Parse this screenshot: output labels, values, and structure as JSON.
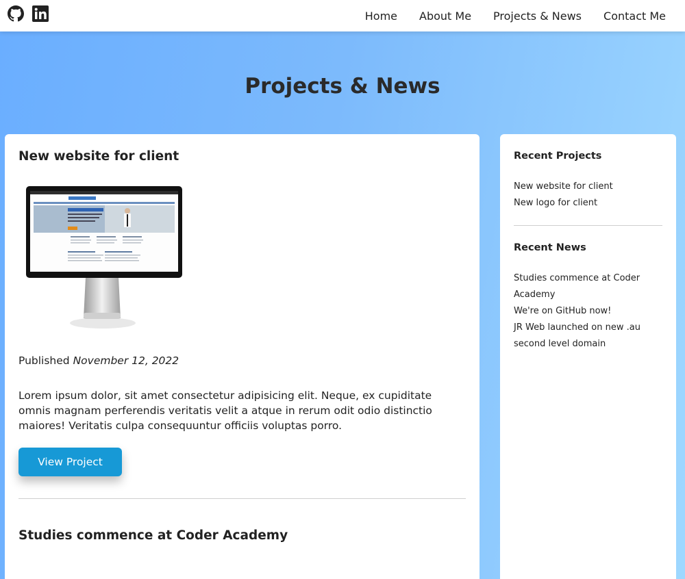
{
  "nav": {
    "github_icon": "github-icon",
    "linkedin_icon": "linkedin-icon",
    "links": [
      "Home",
      "About Me",
      "Projects & News",
      "Contact Me"
    ]
  },
  "page": {
    "title": "Projects & News"
  },
  "posts": [
    {
      "title": "New website for client",
      "image": "monitor-website-screenshot",
      "published_label": "Published",
      "published_date": "November 12, 2022",
      "body": "Lorem ipsum dolor, sit amet consectetur adipisicing elit. Neque, ex cupiditate omnis magnam perferendis veritatis velit a atque in rerum odit odio distinctio maiores! Veritatis culpa consequuntur officiis voluptas porro.",
      "button_label": "View Project"
    },
    {
      "title": "Studies commence at Coder Academy"
    }
  ],
  "sidebar": {
    "recent_projects_heading": "Recent Projects",
    "recent_projects": [
      "New website for client",
      "New logo for client"
    ],
    "recent_news_heading": "Recent News",
    "recent_news": [
      "Studies commence at Coder Academy",
      "We're on GitHub now!",
      "JR Web launched on new .au second level domain"
    ]
  },
  "colors": {
    "accent_button": "#1799d6",
    "background_gradient_start": "#6aaeff",
    "background_gradient_end": "#9fd8ff"
  }
}
